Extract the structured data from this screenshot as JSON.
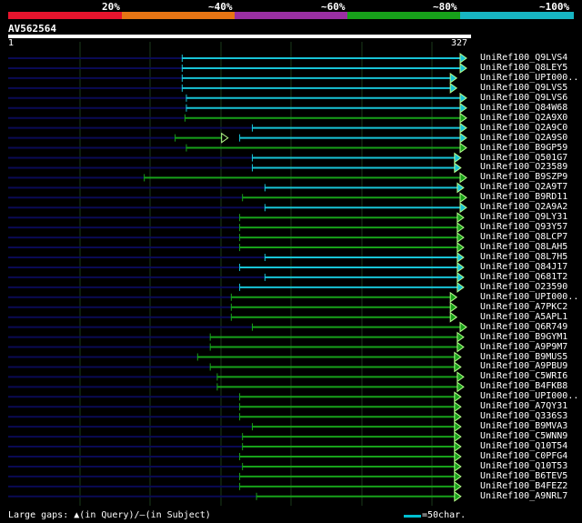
{
  "legend": [
    {
      "label": "20%",
      "color": "#e8142d"
    },
    {
      "label": "~40%",
      "color": "#e87514"
    },
    {
      "label": "~60%",
      "color": "#9a2fa3"
    },
    {
      "label": "~80%",
      "color": "#17a11a"
    },
    {
      "label": "~100%",
      "color": "#17b5c2"
    }
  ],
  "query": {
    "title": "AV562564",
    "start_label": "1",
    "end_label": "327",
    "length": 327
  },
  "colors": {
    "cyan": "#17c3d6",
    "green": "#17a11a",
    "query_line": "#0a0a55",
    "grid": "#1a3a1a"
  },
  "hits": [
    {
      "name": "UniRef100_Q9LVS4",
      "color": "cyan",
      "start": 125,
      "end": 327,
      "faint": 125
    },
    {
      "name": "UniRef100_Q8LEY5",
      "color": "cyan",
      "start": 125,
      "end": 327,
      "faint": 125
    },
    {
      "name": "UniRef100_UPI000..",
      "color": "cyan",
      "start": 125,
      "end": 320,
      "faint": 125
    },
    {
      "name": "UniRef100_Q9LVS5",
      "color": "cyan",
      "start": 125,
      "end": 320,
      "faint": 125
    },
    {
      "name": "UniRef100_Q9LVS6",
      "color": "cyan",
      "start": 128,
      "end": 327,
      "faint": 128
    },
    {
      "name": "UniRef100_Q84W68",
      "color": "cyan",
      "start": 128,
      "end": 327,
      "faint": 128
    },
    {
      "name": "UniRef100_Q2A9X0",
      "color": "green",
      "start": 127,
      "end": 327,
      "faint": 127
    },
    {
      "name": "UniRef100_Q2A9C0",
      "color": "cyan",
      "start": 175,
      "end": 327,
      "faint": 175
    },
    {
      "name": "UniRef100_Q2A9S0",
      "color": "cyan",
      "start": 166,
      "end": 327,
      "faint": 120,
      "extra": {
        "color": "green",
        "start": 120,
        "end": 157
      }
    },
    {
      "name": "UniRef100_B9GP59",
      "color": "green",
      "start": 128,
      "end": 327,
      "faint": 128
    },
    {
      "name": "UniRef100_Q501G7",
      "color": "cyan",
      "start": 175,
      "end": 323,
      "faint": 175
    },
    {
      "name": "UniRef100_O23589",
      "color": "cyan",
      "start": 175,
      "end": 323,
      "faint": 175
    },
    {
      "name": "UniRef100_B9SZP9",
      "color": "green",
      "start": 98,
      "end": 327,
      "faint": 98
    },
    {
      "name": "UniRef100_Q2A9T7",
      "color": "cyan",
      "start": 184,
      "end": 325,
      "faint": 184
    },
    {
      "name": "UniRef100_B9RD11",
      "color": "green",
      "start": 168,
      "end": 327,
      "faint": 168
    },
    {
      "name": "UniRef100_Q2A9A2",
      "color": "cyan",
      "start": 184,
      "end": 327,
      "faint": 184
    },
    {
      "name": "UniRef100_Q9LY31",
      "color": "green",
      "start": 166,
      "end": 325,
      "faint": 166
    },
    {
      "name": "UniRef100_Q93Y57",
      "color": "green",
      "start": 166,
      "end": 325,
      "faint": 166
    },
    {
      "name": "UniRef100_Q8LCP7",
      "color": "green",
      "start": 166,
      "end": 325,
      "faint": 166
    },
    {
      "name": "UniRef100_Q8LAH5",
      "color": "green",
      "start": 166,
      "end": 325,
      "faint": 166
    },
    {
      "name": "UniRef100_Q8L7H5",
      "color": "cyan",
      "start": 184,
      "end": 325,
      "faint": 184
    },
    {
      "name": "UniRef100_Q84J17",
      "color": "cyan",
      "start": 166,
      "end": 325,
      "faint": 166
    },
    {
      "name": "UniRef100_Q681T2",
      "color": "cyan",
      "start": 184,
      "end": 325,
      "faint": 184
    },
    {
      "name": "UniRef100_O23590",
      "color": "cyan",
      "start": 166,
      "end": 325,
      "faint": 166
    },
    {
      "name": "UniRef100_UPI000..",
      "color": "green",
      "start": 160,
      "end": 320,
      "faint": 160
    },
    {
      "name": "UniRef100_A7PKC2",
      "color": "green",
      "start": 160,
      "end": 320,
      "faint": 160
    },
    {
      "name": "UniRef100_A5APL1",
      "color": "green",
      "start": 160,
      "end": 320,
      "faint": 160
    },
    {
      "name": "UniRef100_Q6R749",
      "color": "green",
      "start": 175,
      "end": 327,
      "faint": 175
    },
    {
      "name": "UniRef100_B9GYM1",
      "color": "green",
      "start": 145,
      "end": 325,
      "faint": 145
    },
    {
      "name": "UniRef100_A9P9M7",
      "color": "green",
      "start": 145,
      "end": 325,
      "faint": 145
    },
    {
      "name": "UniRef100_B9MUS5",
      "color": "green",
      "start": 136,
      "end": 323,
      "faint": 136
    },
    {
      "name": "UniRef100_A9PBU9",
      "color": "green",
      "start": 145,
      "end": 323,
      "faint": 145
    },
    {
      "name": "UniRef100_C5WRI6",
      "color": "green",
      "start": 150,
      "end": 325,
      "faint": 150
    },
    {
      "name": "UniRef100_B4FKB8",
      "color": "green",
      "start": 150,
      "end": 325,
      "faint": 150
    },
    {
      "name": "UniRef100_UPI000..",
      "color": "green",
      "start": 166,
      "end": 323,
      "faint": 166
    },
    {
      "name": "UniRef100_A7QY31",
      "color": "green",
      "start": 166,
      "end": 323,
      "faint": 166
    },
    {
      "name": "UniRef100_Q336S3",
      "color": "green",
      "start": 166,
      "end": 323,
      "faint": 166
    },
    {
      "name": "UniRef100_B9MVA3",
      "color": "green",
      "start": 175,
      "end": 323,
      "faint": 175
    },
    {
      "name": "UniRef100_C5WNN9",
      "color": "green",
      "start": 168,
      "end": 323,
      "faint": 168
    },
    {
      "name": "UniRef100_Q10T54",
      "color": "green",
      "start": 168,
      "end": 323,
      "faint": 168
    },
    {
      "name": "UniRef100_C0PFG4",
      "color": "green",
      "start": 166,
      "end": 323,
      "faint": 166
    },
    {
      "name": "UniRef100_Q10T53",
      "color": "green",
      "start": 168,
      "end": 323,
      "faint": 168
    },
    {
      "name": "UniRef100_B6TEV5",
      "color": "green",
      "start": 166,
      "end": 323,
      "faint": 166
    },
    {
      "name": "UniRef100_B4FEZ2",
      "color": "green",
      "start": 166,
      "end": 323,
      "faint": 166
    },
    {
      "name": "UniRef100_A9NRL7",
      "color": "green",
      "start": 178,
      "end": 323,
      "faint": 178
    }
  ],
  "footer": {
    "gaps_text": "Large gaps:",
    "gap_query_glyph": "▲",
    "gap_query_text": "(in Query)/",
    "gap_subject_glyph": "—",
    "gap_subject_text": "(in Subject)",
    "scale_text": "=50char."
  }
}
